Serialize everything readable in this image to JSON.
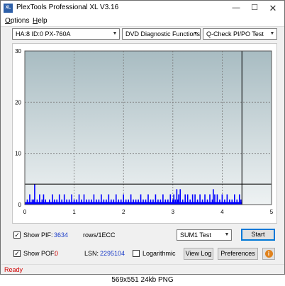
{
  "window": {
    "title": "PlexTools Professional XL V3.16",
    "icon_label": "XL",
    "controls": {
      "minimize": "—",
      "maximize": "☐",
      "close": "✕"
    }
  },
  "menu": {
    "options": {
      "accel": "O",
      "rest": "ptions"
    },
    "help": {
      "accel": "H",
      "rest": "elp"
    }
  },
  "toolbar": {
    "drive": "HA:8 ID:0  PX-760A",
    "function": "DVD Diagnostic Functions",
    "test": "Q-Check PI/PO Test"
  },
  "chart_data": {
    "type": "bar",
    "title": "",
    "xlabel": "",
    "ylabel": "",
    "xlim": [
      0,
      5
    ],
    "ylim": [
      0,
      30
    ],
    "x_ticks": [
      "0",
      "1",
      "2",
      "3",
      "4",
      "5"
    ],
    "y_ticks": [
      "0",
      "10",
      "20",
      "30"
    ],
    "grid": true,
    "threshold": 4,
    "end_marker": 4.4,
    "series": [
      {
        "color": "#0000ff",
        "x": [
          0.05,
          0.1,
          0.15,
          0.18,
          0.2,
          0.25,
          0.3,
          0.35,
          0.38,
          0.42,
          0.5,
          0.56,
          0.6,
          0.65,
          0.7,
          0.75,
          0.8,
          0.85,
          0.9,
          0.95,
          1.0,
          1.05,
          1.1,
          1.15,
          1.2,
          1.25,
          1.3,
          1.35,
          1.4,
          1.45,
          1.5,
          1.55,
          1.6,
          1.65,
          1.7,
          1.75,
          1.8,
          1.85,
          1.9,
          1.95,
          2.0,
          2.05,
          2.1,
          2.15,
          2.2,
          2.25,
          2.3,
          2.35,
          2.4,
          2.45,
          2.5,
          2.55,
          2.6,
          2.65,
          2.7,
          2.75,
          2.8,
          2.85,
          2.9,
          2.95,
          3.0,
          3.02,
          3.05,
          3.08,
          3.1,
          3.12,
          3.15,
          3.2,
          3.25,
          3.3,
          3.35,
          3.4,
          3.45,
          3.5,
          3.55,
          3.6,
          3.65,
          3.7,
          3.75,
          3.8,
          3.82,
          3.85,
          3.9,
          3.95,
          4.0,
          4.05,
          4.1,
          4.15,
          4.2,
          4.25,
          4.3,
          4.35,
          4.38
        ],
        "values": [
          1,
          2,
          1,
          1,
          4,
          1,
          2,
          1,
          2,
          1,
          1,
          2,
          1,
          1,
          2,
          1,
          2,
          1,
          1,
          2,
          1,
          1,
          2,
          1,
          2,
          1,
          1,
          1,
          2,
          1,
          1,
          2,
          1,
          1,
          2,
          1,
          1,
          2,
          1,
          1,
          2,
          1,
          1,
          2,
          1,
          1,
          1,
          2,
          1,
          1,
          2,
          1,
          1,
          2,
          1,
          1,
          2,
          1,
          1,
          2,
          1,
          2,
          1,
          3,
          1,
          2,
          3,
          1,
          2,
          2,
          1,
          2,
          2,
          1,
          2,
          1,
          2,
          1,
          2,
          1,
          3,
          2,
          2,
          1,
          2,
          1,
          2,
          1,
          1,
          2,
          1,
          2,
          1
        ]
      }
    ]
  },
  "stats": {
    "show_pif_label": "Show PIF:",
    "pif_value": "3634",
    "pif_unit": "rows/1ECC",
    "show_pof_label": "Show POF:",
    "pof_value": "0",
    "lsn_label": "LSN:",
    "lsn_value": "2295104",
    "log_label": "Logarithmic"
  },
  "actions": {
    "sum_select": "SUM1 Test",
    "start": "Start",
    "view_log": "View Log",
    "preferences": "Preferences",
    "info": "i"
  },
  "status": {
    "text": "Ready"
  },
  "caption": {
    "text": "569x551  24kb  PNG"
  }
}
